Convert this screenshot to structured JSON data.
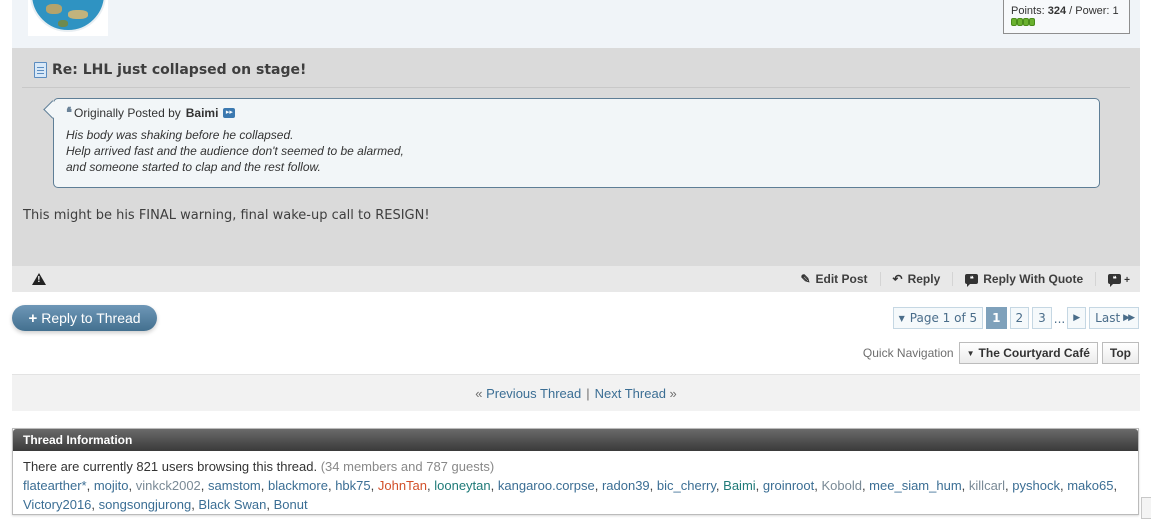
{
  "user_stats": {
    "points_label": "Points:",
    "points_value": "324",
    "power_label": "/ Power: 1",
    "reputation_pips": 4
  },
  "post": {
    "title": "Re: LHL just collapsed on stage!",
    "quote": {
      "prefix": "Originally Posted by",
      "author": "Baimi",
      "lines": [
        "His body was shaking before he collapsed.",
        "Help arrived fast and the audience don't seemed to be alarmed,",
        "and someone started to clap and the rest follow."
      ]
    },
    "message": "This might be his FINAL warning, final wake-up call to RESIGN!",
    "actions": {
      "edit": "Edit Post",
      "reply": "Reply",
      "reply_quote": "Reply With Quote"
    }
  },
  "reply_thread_label": "Reply to Thread",
  "pagination": {
    "label": "Page 1 of 5",
    "pages": [
      "1",
      "2",
      "3"
    ],
    "current": "1",
    "ellipsis": "...",
    "last": "Last"
  },
  "quick_nav": {
    "label": "Quick Navigation",
    "forum": "The Courtyard Café",
    "top": "Top"
  },
  "thread_nav": {
    "prev": "Previous Thread",
    "next": "Next Thread",
    "prev_arrow": "«",
    "next_arrow": "»",
    "separator": "|"
  },
  "thread_info": {
    "title": "Thread Information",
    "count_text": "There are currently 821 users browsing this thread.",
    "breakdown": "(34 members and 787 guests)",
    "users": [
      {
        "name": "flatearther*",
        "color": "#3b6e94"
      },
      {
        "name": "mojito",
        "color": "#3b6e94"
      },
      {
        "name": "vinkck2002",
        "color": "#7a8a96"
      },
      {
        "name": "samstom",
        "color": "#3b6e94"
      },
      {
        "name": "blackmore",
        "color": "#3b6e94"
      },
      {
        "name": "hbk75",
        "color": "#3b6e94"
      },
      {
        "name": "JohnTan",
        "color": "#d2502a"
      },
      {
        "name": "looneytan",
        "color": "#1f7a78"
      },
      {
        "name": "kangaroo.corpse",
        "color": "#3b6e94"
      },
      {
        "name": "radon39",
        "color": "#3b6e94"
      },
      {
        "name": "bic_cherry",
        "color": "#3b6e94"
      },
      {
        "name": "Baimi",
        "color": "#1f7a78"
      },
      {
        "name": "groinroot",
        "color": "#3b6e94"
      },
      {
        "name": "Kobold",
        "color": "#7a8a96"
      },
      {
        "name": "mee_siam_hum",
        "color": "#3b6e94"
      },
      {
        "name": "killcarl",
        "color": "#7a8a96"
      },
      {
        "name": "pyshock",
        "color": "#3b6e94"
      },
      {
        "name": "mako65",
        "color": "#3b6e94"
      },
      {
        "name": "Victory2016",
        "color": "#3b6e94"
      },
      {
        "name": "songsongjurong",
        "color": "#3b6e94"
      },
      {
        "name": "Black Swan",
        "color": "#3b6e94"
      },
      {
        "name": "Bonut",
        "color": "#3b6e94"
      }
    ]
  }
}
